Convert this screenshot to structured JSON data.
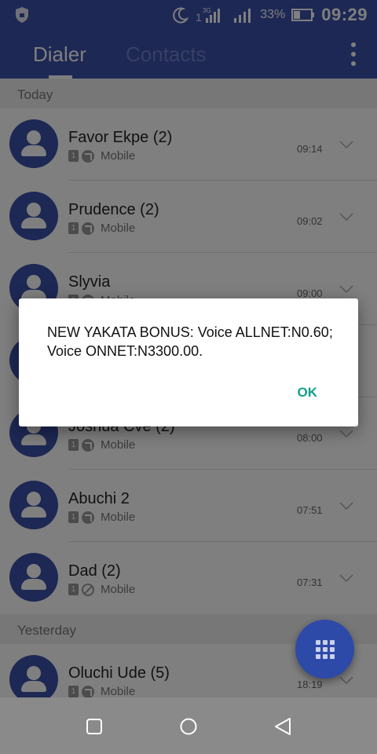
{
  "status_bar": {
    "signal_label": "3G",
    "battery_pct": "33%",
    "time": "09:29",
    "icons": [
      "shield-icon",
      "moon-icon",
      "sim-1-signal-icon",
      "signal-icon",
      "battery-icon"
    ]
  },
  "tabs": {
    "dialer": "Dialer",
    "contacts": "Contacts"
  },
  "sections": [
    {
      "header": "Today",
      "calls": [
        {
          "name": "Favor Ekpe (2)",
          "sim": "1",
          "type": "outgoing",
          "label": "Mobile",
          "time": "09:14"
        },
        {
          "name": "Prudence (2)",
          "sim": "1",
          "type": "outgoing",
          "label": "Mobile",
          "time": "09:02"
        },
        {
          "name": "Slyvia",
          "sim": "1",
          "type": "outgoing",
          "label": "Mobile",
          "time": "09:00"
        },
        {
          "name": "",
          "sim": "1",
          "type": "outgoing",
          "label": "",
          "time": ""
        },
        {
          "name": "Joshua Cve (2)",
          "sim": "1",
          "type": "outgoing",
          "label": "Mobile",
          "time": "08:00"
        },
        {
          "name": "Abuchi 2",
          "sim": "1",
          "type": "outgoing",
          "label": "Mobile",
          "time": "07:51"
        },
        {
          "name": "Dad (2)",
          "sim": "1",
          "type": "missed",
          "label": "Mobile",
          "time": "07:31"
        }
      ]
    },
    {
      "header": "Yesterday",
      "calls": [
        {
          "name": "Oluchi Ude (5)",
          "sim": "1",
          "type": "outgoing",
          "label": "Mobile",
          "time": "18:19"
        }
      ]
    }
  ],
  "dialog": {
    "message": "NEW YAKATA BONUS: Voice ALLNET:N0.60; Voice ONNET:N3300.00.",
    "ok_label": "OK"
  },
  "colors": {
    "app_bar": "#3a50a8",
    "avatar": "#3a50a8",
    "fab": "#2e4aa8",
    "dialog_button": "#13a08a"
  }
}
